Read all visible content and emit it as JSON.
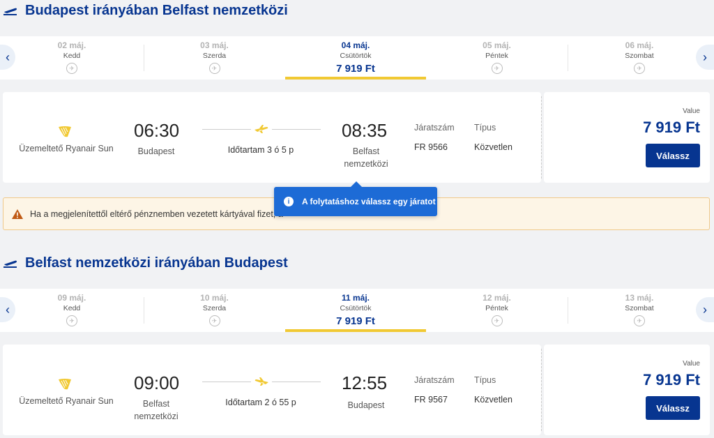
{
  "colors": {
    "brand": "#073590",
    "accent_yellow": "#f1c933",
    "tooltip_blue": "#1d6bd6",
    "warning": "#c05a14"
  },
  "outbound": {
    "title": "Budapest irányában Belfast nemzetközi",
    "dates": [
      {
        "date": "02 máj.",
        "day": "Kedd",
        "icon": "no-flight-icon"
      },
      {
        "date": "03 máj.",
        "day": "Szerda",
        "icon": "no-flight-icon"
      },
      {
        "date": "04 máj.",
        "day": "Csütörtök",
        "price": "7 919 Ft"
      },
      {
        "date": "05 máj.",
        "day": "Péntek",
        "icon": "no-flight-icon"
      },
      {
        "date": "06 máj.",
        "day": "Szombat",
        "icon": "no-flight-icon"
      }
    ],
    "flight": {
      "operator": "Üzemeltető Ryanair Sun",
      "dep_time": "06:30",
      "dep_place": "Budapest",
      "duration": "Időtartam 3 ó 5 p",
      "arr_time": "08:35",
      "arr_place_1": "Belfast",
      "arr_place_2": "nemzetközi",
      "flight_no_label": "Járatszám",
      "flight_no": "FR 9566",
      "type_label": "Típus",
      "type": "Közvetlen",
      "fare_label": "Value",
      "price": "7 919 Ft",
      "select_label": "Válassz"
    }
  },
  "tooltip": {
    "text": "A folytatáshoz válassz egy járatot"
  },
  "notice": {
    "text": "Ha a megjelenítettől eltérő pénznemben vezetett kártyával fizet, a"
  },
  "inbound": {
    "title": "Belfast nemzetközi irányában Budapest",
    "dates": [
      {
        "date": "09 máj.",
        "day": "Kedd",
        "icon": "no-flight-icon"
      },
      {
        "date": "10 máj.",
        "day": "Szerda",
        "icon": "no-flight-icon"
      },
      {
        "date": "11 máj.",
        "day": "Csütörtök",
        "price": "7 919 Ft"
      },
      {
        "date": "12 máj.",
        "day": "Péntek",
        "icon": "no-flight-icon"
      },
      {
        "date": "13 máj.",
        "day": "Szombat",
        "icon": "no-flight-icon"
      }
    ],
    "flight": {
      "operator": "Üzemeltető Ryanair Sun",
      "dep_time": "09:00",
      "dep_place_1": "Belfast",
      "dep_place_2": "nemzetközi",
      "duration": "Időtartam 2 ó 55 p",
      "arr_time": "12:55",
      "arr_place": "Budapest",
      "flight_no_label": "Járatszám",
      "flight_no": "FR 9567",
      "type_label": "Típus",
      "type": "Közvetlen",
      "fare_label": "Value",
      "price": "7 919 Ft",
      "select_label": "Válassz"
    }
  }
}
